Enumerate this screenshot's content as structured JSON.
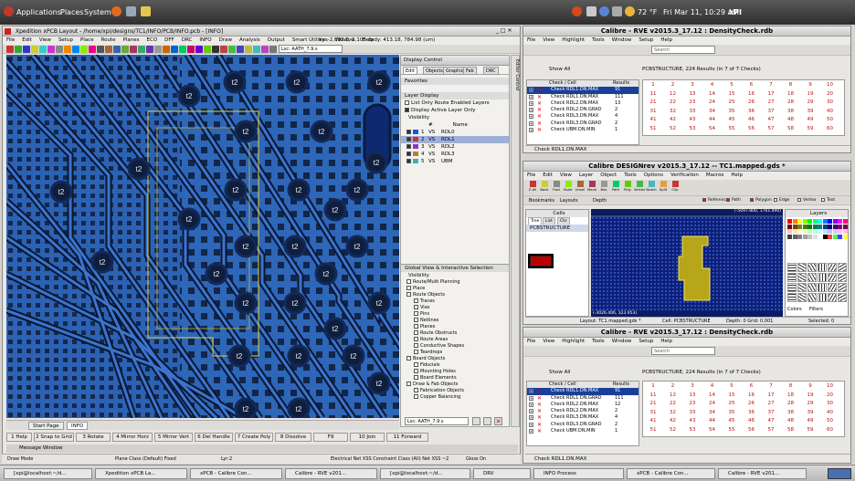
{
  "topbar": {
    "applications": "Applications",
    "places": "Places",
    "system": "System",
    "weather": "72 °F",
    "datetime": "Fri Mar 11, 10:29 AM",
    "user": "xPI"
  },
  "xpcb": {
    "title": "Xpedition xPCB Layout - /home/xpi/designs/TC1/INFO/PCB/INFO.pcb - [INFO]",
    "menus": [
      "File",
      "Edit",
      "View",
      "Setup",
      "Place",
      "Route",
      "Planes",
      "ECO",
      "DFF",
      "DRC",
      "INFO",
      "Draw",
      "Analysis",
      "Output",
      "Smart Utilities",
      "Window",
      "Help"
    ],
    "coords": "xy: -2,092.0, 1,105  dxdy: 413.18, 784.98 (um)",
    "scheme": "Lsc: AATH_7.9.s",
    "canvas_labels": [
      "t2",
      "t2",
      "t2",
      "t2",
      "t2",
      "t2",
      "t2",
      "t2",
      "t2",
      "t2",
      "t2",
      "t2",
      "t2",
      "t2",
      "t2",
      "t2",
      "t2",
      "t2",
      "t2",
      "t2",
      "t2",
      "t2",
      "t2",
      "t2",
      "t2",
      "t2",
      "t2",
      "t2",
      "t2",
      "t2"
    ],
    "tabs": [
      "Start Page",
      "INFO"
    ],
    "function_keys": [
      "1 Help",
      "2 Snap to Grid",
      "3 Rotate",
      "4 Mirror Horz",
      "5 Mirror Vert",
      "6 Del Handle",
      "7 Create Poly",
      "8 Dissolve",
      "F9",
      "10 Join",
      "11 Forward"
    ],
    "message_window": "Message Window",
    "status": {
      "mode": "Draw Mode",
      "plane": "Plane Class (Default) Fixed",
      "layer": "Lyr:2",
      "net": "Electrical Net XSS Constraint Class (All) Net XSS ~2",
      "gloss": "Gloss On"
    }
  },
  "display_control": {
    "title": "Display Control",
    "sidebar_title": "Editor Control",
    "tabs": [
      "Edit",
      "Objects",
      "Graphic",
      "Fab",
      "DRC"
    ],
    "favorites": "Favorites",
    "layer_display": "Layer Display",
    "opts": [
      "List Only Route Enabled Layers",
      "Display Active Layer Only"
    ],
    "visibility": "Visibility",
    "columns": [
      "#",
      "Name"
    ],
    "layers": [
      {
        "n": "1",
        "t": "VS",
        "name": "RDL0",
        "color": "#1d56d8"
      },
      {
        "n": "2",
        "t": "VS",
        "name": "RDL1",
        "color": "#c33"
      },
      {
        "n": "3",
        "t": "VS",
        "name": "RDL2",
        "color": "#8a3ab8"
      },
      {
        "n": "4",
        "t": "VS",
        "name": "RDL3",
        "color": "#c07a30"
      },
      {
        "n": "5",
        "t": "VS",
        "name": "UBM",
        "color": "#3bb3b3"
      }
    ],
    "global_view": "Global View & Interactive Selection",
    "vis": "Visibility",
    "tree": [
      "Route/Multi Planning",
      "Place",
      "Route Objects",
      "Traces",
      "Vias",
      "Pins",
      "Netlines",
      "Planes",
      "Route Obstructs",
      "Route Areas",
      "Conductive Shapes",
      "Teardrops",
      "Board Objects",
      "Fiducials",
      "Mounting Holes",
      "Board Elements",
      "Draw & Fab Objects",
      "Fabrication Objects",
      "Copper Balancing"
    ],
    "scheme": "Lsc: AATH_7.9.s"
  },
  "rve_top": {
    "title": "Calibre - RVE v2015.3_17.12 : DensityCheck.rdb",
    "menus": [
      "File",
      "View",
      "Highlight",
      "Tools",
      "Window",
      "Setup",
      "Help"
    ],
    "search_placeholder": "Search",
    "show_all": "Show All",
    "summary": "PCBSTRUCTURE, 224 Results (in 7 of 7 Checks)",
    "col_check": "Check / Cell",
    "col_results": "Results",
    "checks": [
      {
        "name": "Check RDL1.DN.MAX",
        "val": "91"
      },
      {
        "name": "Check RDL1.DN.MAX",
        "val": "111"
      },
      {
        "name": "Check RDL2.DN.MAX",
        "val": "13"
      },
      {
        "name": "Check RDL2.DN.GRAD",
        "val": "2"
      },
      {
        "name": "Check RDL3.DN.MAX",
        "val": "4"
      },
      {
        "name": "Check RDL3.DN.GRAD",
        "val": "2"
      },
      {
        "name": "Check UBM.DN.MIN",
        "val": "1"
      }
    ],
    "grid": [
      [
        "1",
        "2",
        "3",
        "4",
        "5",
        "6",
        "7",
        "8",
        "9",
        "10"
      ],
      [
        "11",
        "12",
        "13",
        "14",
        "15",
        "16",
        "17",
        "18",
        "19",
        "20"
      ],
      [
        "21",
        "22",
        "23",
        "24",
        "25",
        "26",
        "27",
        "28",
        "29",
        "30"
      ],
      [
        "31",
        "32",
        "33",
        "34",
        "35",
        "36",
        "37",
        "38",
        "39",
        "40"
      ],
      [
        "41",
        "42",
        "43",
        "44",
        "45",
        "46",
        "47",
        "48",
        "49",
        "50"
      ],
      [
        "51",
        "52",
        "53",
        "54",
        "55",
        "56",
        "57",
        "58",
        "59",
        "60"
      ]
    ],
    "footer": "Check RDL1.DN.MAX"
  },
  "desrev": {
    "title": "Calibre DESIGNrev v2015.3_17.12 -- TC1.mapped.gds *",
    "menus": [
      "File",
      "Edit",
      "View",
      "Layer",
      "Object",
      "Tools",
      "Options",
      "Verification",
      "Macros",
      "Help"
    ],
    "tools": [
      "Z All",
      "Back",
      "Fwd",
      "Ruler",
      "Unsel",
      "Move",
      "Box",
      "Path",
      "Poly",
      "Vertex",
      "Notch",
      "Split",
      "Clip"
    ],
    "bookmarks": "Bookmarks",
    "layouts": "Layouts",
    "depth": "Depth",
    "options": [
      "Reference",
      "Path",
      "Polygon",
      "Edge",
      "Vertex",
      "Text"
    ],
    "cells": "Cells",
    "cell_tabs": [
      "Tree",
      "List",
      "Ctx"
    ],
    "cell_name": "PCBSTRUCTURE",
    "layers_title": "Layers",
    "coords_top": "(-5097.800, 1761.490)",
    "coords_bottom": "(-3026.406, 323.953)",
    "colors": "Colors",
    "filters": "Filters",
    "layout_label": "Layout: TC1.mapped.gds *",
    "cell_label": "Cell: PCBSTRUCTURE",
    "depth_label": "Depth: 0  Grid: 0.001",
    "sel_label": "Selected: 0"
  },
  "rve_bottom": {
    "title": "Calibre - RVE v2015.3_17.12 : DensityCheck.rdb",
    "menus": [
      "File",
      "View",
      "Highlight",
      "Tools",
      "Window",
      "Setup",
      "Help"
    ],
    "search_placeholder": "Search",
    "show_all": "Show All",
    "summary": "PCBSTRUCTURE, 224 Results (in 7 of 7 Checks)",
    "col_check": "Check / Cell",
    "col_results": "Results",
    "checks": [
      {
        "name": "Check RDL1.DN.MAX",
        "val": "91"
      },
      {
        "name": "Check RDL1.DN.GRAD",
        "val": "111"
      },
      {
        "name": "Check RDL2.DN.MAX",
        "val": "12"
      },
      {
        "name": "Check RDL2.DN.MAX",
        "val": "2"
      },
      {
        "name": "Check RDL3.DN.MAX",
        "val": "4"
      },
      {
        "name": "Check RDL3.DN.GRAD",
        "val": "2"
      },
      {
        "name": "Check UBM.DN.MIN",
        "val": "1"
      }
    ],
    "grid": [
      [
        "1",
        "2",
        "3",
        "4",
        "5",
        "6",
        "7",
        "8",
        "9",
        "10"
      ],
      [
        "11",
        "12",
        "13",
        "14",
        "15",
        "16",
        "17",
        "18",
        "19",
        "20"
      ],
      [
        "21",
        "22",
        "23",
        "24",
        "25",
        "26",
        "27",
        "28",
        "29",
        "30"
      ],
      [
        "31",
        "32",
        "33",
        "34",
        "35",
        "36",
        "37",
        "38",
        "39",
        "40"
      ],
      [
        "41",
        "42",
        "43",
        "44",
        "45",
        "46",
        "47",
        "48",
        "49",
        "50"
      ],
      [
        "51",
        "52",
        "53",
        "54",
        "55",
        "56",
        "57",
        "58",
        "59",
        "60"
      ]
    ],
    "footer": "Check RDL1.DN.MAX"
  },
  "taskbar": [
    "[xpi@localhost:~/d...",
    "Xpedition xPCB La...",
    "xPCB - Calibre Con...",
    "Calibre - RVE v201...",
    "[xpi@localhost:~/d...",
    "DRV",
    "INFO Process",
    "xPCB - Calibre Con...",
    "Calibre - RVE v201..."
  ]
}
